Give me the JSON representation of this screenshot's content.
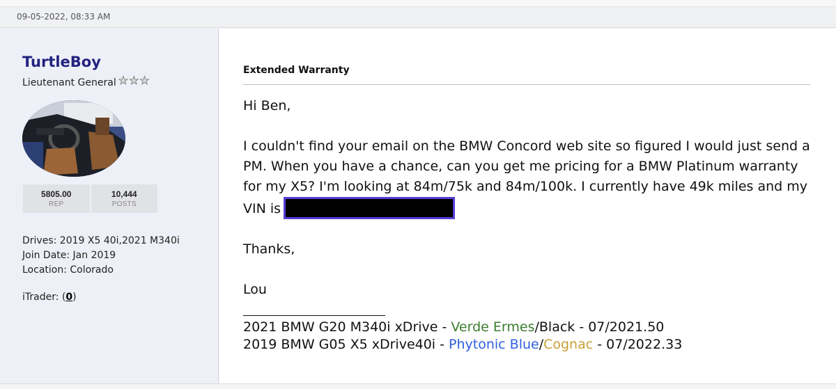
{
  "post": {
    "date": "09-05-2022, 08:33 AM",
    "title": "Extended Warranty",
    "greeting": "Hi Ben,",
    "paragraph1": "I couldn't find your email on the BMW Concord web site so figured I would just send a PM. When you have a chance, can you get me pricing for a BMW Platinum warranty for my X5? I'm looking at 84m/75k and 84m/100k. I currently have 49k miles and my VIN is",
    "thanks": "Thanks,",
    "closing": "Lou"
  },
  "user": {
    "name": "TurtleBoy",
    "rank": "Lieutenant General",
    "rep_value": "5805.00",
    "rep_label": "REP",
    "posts_value": "10,444",
    "posts_label": "POSTS",
    "drives": "Drives: 2019 X5 40i,2021 M340i",
    "join_date": "Join Date: Jan 2019",
    "location": "Location: Colorado",
    "itrader_label": "iTrader: (",
    "itrader_value": "0",
    "itrader_close": ")"
  },
  "signature": {
    "line1": {
      "prefix": "2021 BMW G20 M340i xDrive - ",
      "color1": "Verde Ermes",
      "sep": "/",
      "color2": "Black",
      "suffix": " - 07/2021.50"
    },
    "line2": {
      "prefix": "2019 BMW G05 X5 xDrive40i - ",
      "color1": "Phytonic Blue",
      "sep": "/",
      "color2": "Cognac",
      "suffix": " - 07/2022.33"
    }
  },
  "colors": {
    "username": "#22237f",
    "verde_ermes": "#3a7d2c",
    "phytonic_blue": "#2e5fe0",
    "cognac": "#c8a034",
    "redaction_border": "#5b3cd6"
  },
  "icons": {
    "rank_stars": [
      "star-icon",
      "star-icon",
      "star-icon"
    ],
    "avatar": "car-interior-photo"
  }
}
